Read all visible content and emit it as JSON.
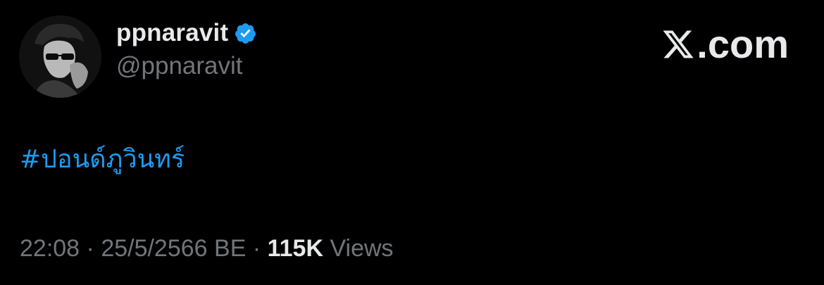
{
  "author": {
    "display_name": "ppnaravit",
    "handle": "@ppnaravit",
    "verified": true,
    "avatar_icon": "profile-photo"
  },
  "brand": {
    "label": ".com",
    "icon": "x-logo-icon"
  },
  "tweet": {
    "text": "#ปอนด์ภูวินทร์"
  },
  "meta": {
    "time": "22:08",
    "separator1": " · ",
    "date": "25/5/2566 BE",
    "separator2": " · ",
    "views_count": "115K",
    "views_label": " Views"
  },
  "colors": {
    "background": "#000000",
    "primary_text": "#e7e9ea",
    "secondary_text": "#71767b",
    "link": "#1d9bf0",
    "verified_badge": "#1d9bf0"
  }
}
